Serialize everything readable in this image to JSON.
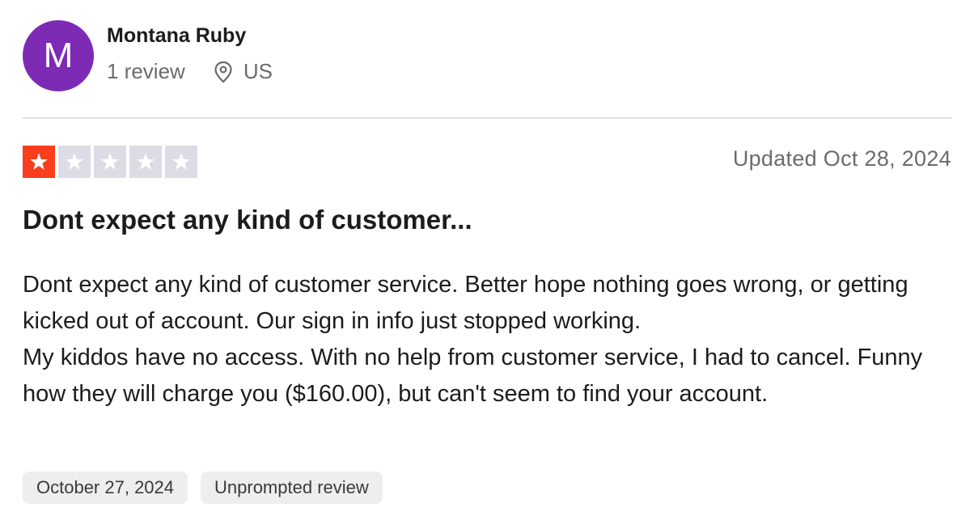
{
  "reviewer": {
    "avatar_initial": "M",
    "avatar_color": "#7d2bb4",
    "name": "Montana Ruby",
    "review_count": "1 review",
    "location_icon": "map-pin-icon",
    "country": "US"
  },
  "review": {
    "rating": 1,
    "rating_max": 5,
    "star_on_color": "#fa3d1c",
    "star_off_color": "#dcdce6",
    "updated": "Updated Oct 28, 2024",
    "title": "Dont expect any kind of customer...",
    "body_line1": "Dont expect any kind of customer service. Better hope nothing goes wrong, or getting kicked out of account. Our sign in info just stopped working.",
    "body_line2": "My kiddos have no access. With no help from customer service, I had to cancel. Funny how they will charge you ($160.00), but can't seem to find your account.",
    "date_chip": "October 27, 2024",
    "type_chip": "Unprompted review"
  }
}
